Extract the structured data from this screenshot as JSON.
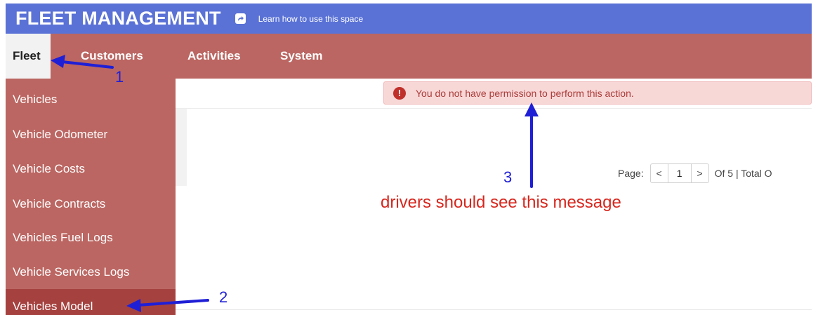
{
  "header": {
    "app_title": "FLEET MANAGEMENT",
    "share_icon": "share-arrow-icon",
    "help_link": "Learn how to use this space"
  },
  "menu": {
    "items": [
      {
        "label": "Fleet",
        "active": true
      },
      {
        "label": "Customers"
      },
      {
        "label": "Activities"
      },
      {
        "label": "System"
      }
    ]
  },
  "fleet_dropdown": {
    "items": [
      {
        "label": "Vehicles"
      },
      {
        "label": "Vehicle Odometer"
      },
      {
        "label": "Vehicle Costs"
      },
      {
        "label": "Vehicle Contracts"
      },
      {
        "label": "Vehicles Fuel Logs"
      },
      {
        "label": "Vehicle Services Logs"
      },
      {
        "label": "Vehicles Model",
        "selected": true
      }
    ]
  },
  "alert": {
    "icon": "exclamation-circle-icon",
    "message": "You do not have permission to perform this action."
  },
  "pagination": {
    "page_label": "Page:",
    "prev_icon": "<",
    "current_page": "1",
    "next_icon": ">",
    "of_text": "Of 5 | Total O"
  },
  "annotations": {
    "marker_1": "1",
    "marker_2": "2",
    "marker_3": "3",
    "note": "drivers should see this message"
  },
  "colors": {
    "header_blue": "#5a72d6",
    "menu_red": "#bb6662",
    "selected_red": "#a5423f",
    "annotation_blue": "#1f1fd6",
    "annotation_red": "#d7261d"
  }
}
